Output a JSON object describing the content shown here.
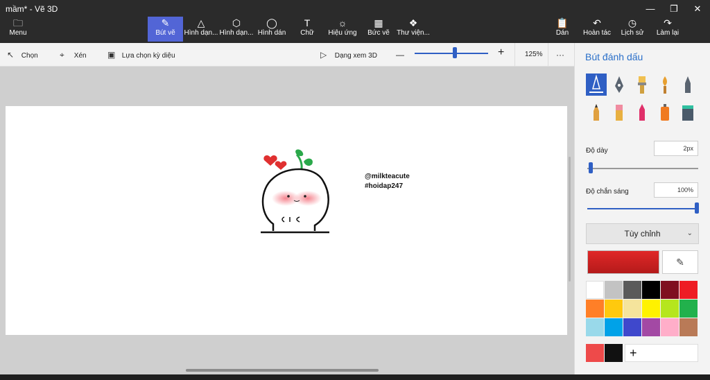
{
  "window": {
    "title": "mầm* - Vẽ 3D",
    "minimize_icon": "minimize-icon",
    "maximize_icon": "maximize-icon",
    "close_icon": "close-icon"
  },
  "ribbon": {
    "menu": {
      "label": "Menu",
      "icon": "folder-icon"
    },
    "tools": [
      {
        "label": "Bút vẽ",
        "icon": "brush-icon",
        "active": true
      },
      {
        "label": "Hình dạn...",
        "icon": "2d-shapes-icon"
      },
      {
        "label": "Hình dạn...",
        "icon": "3d-shapes-icon"
      },
      {
        "label": "Hình dán",
        "icon": "stickers-icon"
      },
      {
        "label": "Chữ",
        "icon": "text-icon"
      },
      {
        "label": "Hiệu ứng",
        "icon": "effects-icon"
      },
      {
        "label": "Bức vẽ",
        "icon": "canvas-icon"
      },
      {
        "label": "Thư viện...",
        "icon": "library-icon"
      }
    ],
    "actions": [
      {
        "label": "Dán",
        "icon": "paste-icon"
      },
      {
        "label": "Hoàn tác",
        "icon": "undo-icon"
      },
      {
        "label": "Lịch sử",
        "icon": "history-icon"
      },
      {
        "label": "Làm lại",
        "icon": "redo-icon"
      }
    ]
  },
  "toolbar": {
    "select": "Chọn",
    "crop": "Xén",
    "magic_select": "Lựa chọn kỳ diệu",
    "view3d": "Dạng xem 3D",
    "zoom_minus": "—",
    "zoom_plus": "+",
    "zoom_value": "125%",
    "zoom_fraction": 0.55,
    "more": "···"
  },
  "canvas": {
    "watermark_line1": "@milkteacute",
    "watermark_line2": "#hoidap247"
  },
  "panel": {
    "title": "Bút đánh dấu",
    "brushes": [
      {
        "name": "marker",
        "icon": "marker-icon"
      },
      {
        "name": "calligraphy pen",
        "icon": "calligraphy-pen-icon"
      },
      {
        "name": "oil brush",
        "icon": "oil-brush-icon"
      },
      {
        "name": "watercolor",
        "icon": "watercolor-icon"
      },
      {
        "name": "pixel pen",
        "icon": "pixel-pen-icon"
      },
      {
        "name": "pencil",
        "icon": "pencil-icon"
      },
      {
        "name": "eraser",
        "icon": "eraser-icon"
      },
      {
        "name": "crayon",
        "icon": "crayon-icon"
      },
      {
        "name": "spray can",
        "icon": "spray-can-icon"
      },
      {
        "name": "fill",
        "icon": "fill-bucket-icon"
      }
    ],
    "thickness_label": "Độ dày",
    "thickness_value": "2px",
    "thickness_fraction": 0.02,
    "opacity_label": "Độ chắn sáng",
    "opacity_value": "100%",
    "opacity_fraction": 1.0,
    "preset": "Tùy chỉnh",
    "current_color": "#e02828",
    "palette": [
      "#ffffff",
      "#c3c3c3",
      "#5a5a5a",
      "#000000",
      "#7f0f1f",
      "#ee1c24",
      "#ff7f27",
      "#ffc90e",
      "#f5e49c",
      "#fff200",
      "#b5e61d",
      "#22b14c",
      "#99d9ea",
      "#00a2e8",
      "#3f48cc",
      "#a349a4",
      "#ffaec9",
      "#b97a57"
    ],
    "recent": [
      "#ee4a4a",
      "#111111"
    ],
    "add_color": "+"
  }
}
